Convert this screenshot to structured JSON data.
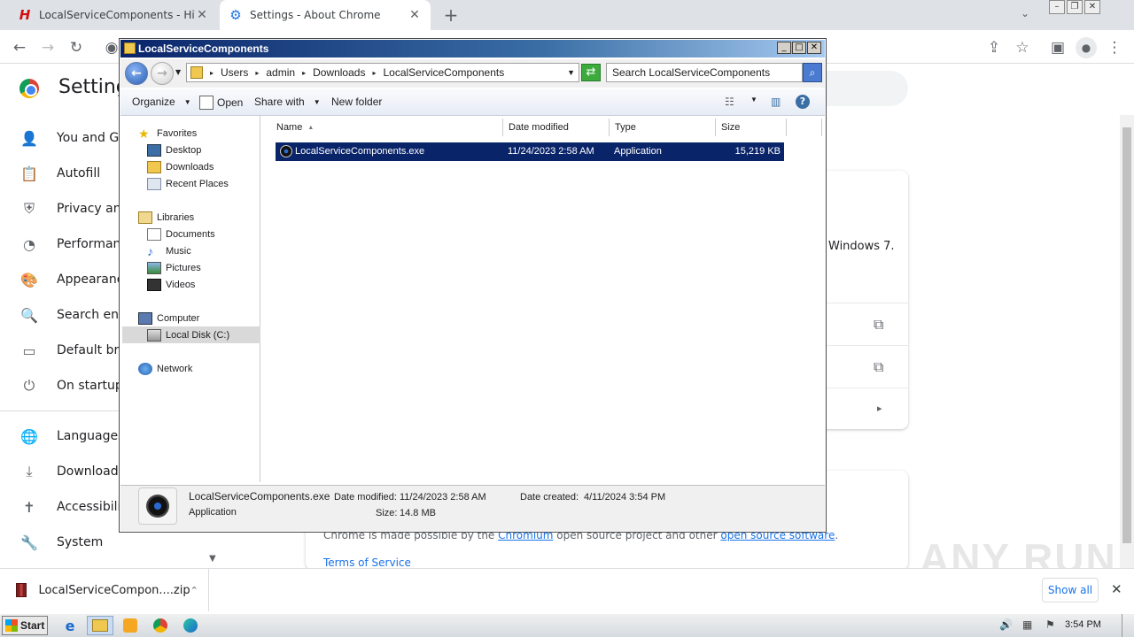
{
  "tabs": [
    {
      "title": "LocalServiceComponents - HiTools - H",
      "favicon": "H"
    },
    {
      "title": "Settings - About Chrome"
    }
  ],
  "settings": {
    "title": "Setting",
    "nav": [
      {
        "label": "You and Go",
        "icon": "person-icon"
      },
      {
        "label": "Autofill",
        "icon": "clipboard-icon"
      },
      {
        "label": "Privacy and",
        "icon": "shield-icon"
      },
      {
        "label": "Performan",
        "icon": "gauge-icon"
      },
      {
        "label": "Appearanc",
        "icon": "palette-icon"
      },
      {
        "label": "Search eng",
        "icon": "search-icon"
      },
      {
        "label": "Default bro",
        "icon": "browser-icon"
      },
      {
        "label": "On startup",
        "icon": "power-icon"
      },
      {
        "label": "Languages",
        "icon": "globe-icon"
      },
      {
        "label": "Downloads",
        "icon": "download-icon"
      },
      {
        "label": "Accessibili",
        "icon": "accessibility-icon"
      },
      {
        "label": "System",
        "icon": "wrench-icon"
      }
    ],
    "about_fragment": "Windows 7.",
    "footer_made_possible_prefix": "Chrome is made possible by the",
    "footer_chromium": "Chromium",
    "footer_middle": "open source project and other",
    "footer_oss": "open source software",
    "footer_end": ".",
    "terms": "Terms of Service"
  },
  "explorer": {
    "title": "LocalServiceComponents",
    "breadcrumb": [
      "Users",
      "admin",
      "Downloads",
      "LocalServiceComponents"
    ],
    "search_placeholder": "Search LocalServiceComponents",
    "commands": {
      "organize": "Organize",
      "open": "Open",
      "share": "Share with",
      "new_folder": "New folder"
    },
    "tree": {
      "favorites": "Favorites",
      "desktop": "Desktop",
      "downloads": "Downloads",
      "recent": "Recent Places",
      "libraries": "Libraries",
      "documents": "Documents",
      "music": "Music",
      "pictures": "Pictures",
      "videos": "Videos",
      "computer": "Computer",
      "local_disk": "Local Disk (C:)",
      "network": "Network"
    },
    "columns": {
      "name": "Name",
      "date": "Date modified",
      "type": "Type",
      "size": "Size"
    },
    "files": [
      {
        "name": "LocalServiceComponents.exe",
        "date": "11/24/2023 2:58 AM",
        "type": "Application",
        "size": "15,219 KB"
      }
    ],
    "details": {
      "name": "LocalServiceComponents.exe",
      "type": "Application",
      "date_modified_label": "Date modified:",
      "date_modified": "11/24/2023 2:58 AM",
      "size_label": "Size:",
      "size": "14.8 MB",
      "date_created_label": "Date created:",
      "date_created": "4/11/2024 3:54 PM"
    }
  },
  "download_bar": {
    "item": "LocalServiceCompon....zip",
    "show_all": "Show all"
  },
  "taskbar": {
    "start": "Start",
    "time": "3:54 PM"
  },
  "watermark": "ANY RUN"
}
